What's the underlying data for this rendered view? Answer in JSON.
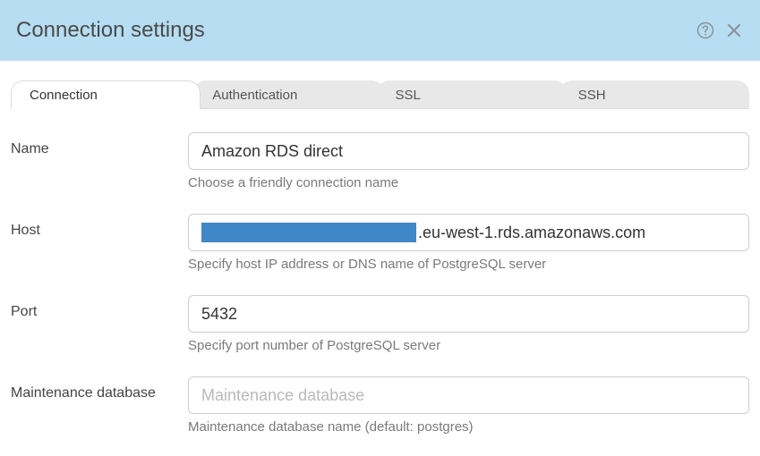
{
  "header": {
    "title": "Connection settings"
  },
  "tabs": [
    {
      "id": "connection",
      "label": "Connection",
      "active": true
    },
    {
      "id": "authentication",
      "label": "Authentication",
      "active": false
    },
    {
      "id": "ssl",
      "label": "SSL",
      "active": false
    },
    {
      "id": "ssh",
      "label": "SSH",
      "active": false
    }
  ],
  "fields": {
    "name": {
      "label": "Name",
      "value": "Amazon RDS direct",
      "hint": "Choose a friendly connection name"
    },
    "host": {
      "label": "Host",
      "value_suffix": ".eu-west-1.rds.amazonaws.com",
      "hint": "Specify host IP address or DNS name of PostgreSQL server"
    },
    "port": {
      "label": "Port",
      "value": "5432",
      "hint": "Specify port number of PostgreSQL server"
    },
    "maintenance_db": {
      "label": "Maintenance database",
      "value": "",
      "placeholder": "Maintenance database",
      "hint": "Maintenance database name (default: postgres)"
    }
  }
}
